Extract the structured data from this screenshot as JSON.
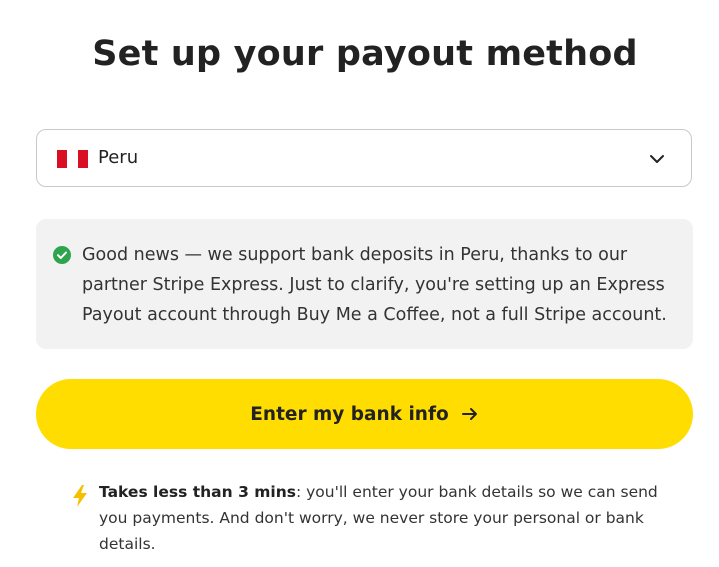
{
  "page": {
    "title": "Set up your payout method"
  },
  "country_select": {
    "selected": "Peru",
    "flag_icon": "peru-flag-icon",
    "dropdown_icon": "chevron-down-icon"
  },
  "notice": {
    "icon": "check-circle-icon",
    "icon_color": "#2ea44f",
    "text": "Good news — we support bank deposits in Peru, thanks to our partner Stripe Express. Just to clarify, you're setting up an Express Payout account through Buy Me a Coffee, not a full Stripe account."
  },
  "cta": {
    "label": "Enter my bank info",
    "icon": "arrow-right-icon",
    "color": "#ffdd00"
  },
  "info": {
    "icon": "lightning-bolt-icon",
    "icon_color": "#f6c000",
    "bold_text": "Takes less than 3 mins",
    "text": ": you'll enter your bank details so we can send you payments. And don't worry, we never store your personal or bank details."
  }
}
